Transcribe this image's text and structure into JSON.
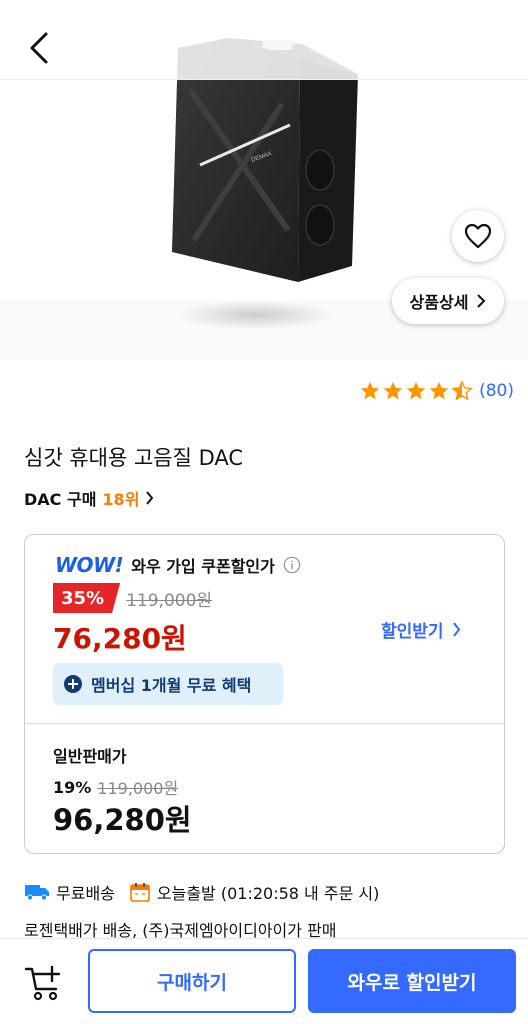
{
  "product_image": {
    "device_brand_mark": "DEMAX"
  },
  "image_actions": {
    "detail_label": "상품상세"
  },
  "rating": {
    "stars": 4.5,
    "review_count": "(80)"
  },
  "product": {
    "title": "심갓 휴대용 고음질 DAC",
    "rank_category": "DAC 구매",
    "rank_number": "18위"
  },
  "wow_price": {
    "logo": "WOW!",
    "label": "와우 가입 쿠폰할인가",
    "discount_badge": "35%",
    "original_price": "119,000원",
    "price": "76,280원",
    "discount_link": "할인받기",
    "membership_benefit": "멤버십 1개월 무료 혜택"
  },
  "normal_price": {
    "label": "일반판매가",
    "discount_pct": "19%",
    "original_price": "119,000원",
    "price": "96,280원"
  },
  "delivery": {
    "free_shipping": "무료배송",
    "ship_today": "오늘출발 (01:20:58 내 주문 시)",
    "seller_info": "로젠택배가 배송, (주)국제엠아이디아이가 판매"
  },
  "bottom_bar": {
    "buy_label": "구매하기",
    "wow_label": "와우로 할인받기"
  },
  "colors": {
    "accent_blue": "#346aff",
    "discount_red": "#cb1400",
    "rank_orange": "#ff7800",
    "star": "#ff9600"
  }
}
